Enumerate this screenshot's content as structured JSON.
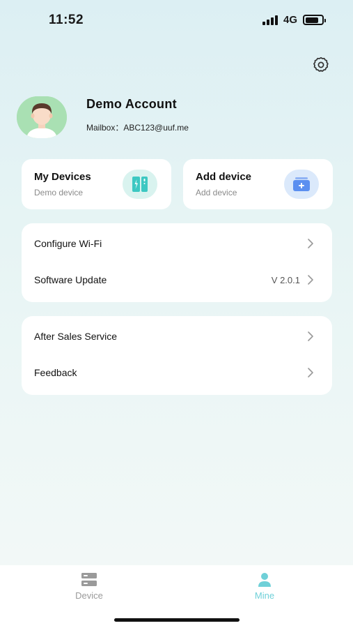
{
  "status": {
    "time": "11:52",
    "network": "4G",
    "battery_level": 0.82
  },
  "header": {
    "settings_icon": "gear-icon"
  },
  "profile": {
    "name": "Demo Account",
    "mailbox": "Mailbox：ABC123@uuf.me"
  },
  "tiles": {
    "my_devices": {
      "title": "My Devices",
      "subtitle": "Demo device",
      "icon": "devices-icon"
    },
    "add_device": {
      "title": "Add device",
      "subtitle": "Add device",
      "icon": "add-device-icon"
    }
  },
  "menu": {
    "configure_wifi": {
      "label": "Configure Wi-Fi"
    },
    "software_update": {
      "label": "Software Update",
      "value": "V 2.0.1"
    },
    "after_sales": {
      "label": "After Sales Service"
    },
    "feedback": {
      "label": "Feedback"
    }
  },
  "tabbar": {
    "device": {
      "label": "Device"
    },
    "mine": {
      "label": "Mine",
      "active": true
    }
  },
  "colors": {
    "accent": "#6fd0d8",
    "tab_inactive": "#9a9a9a",
    "device_icon_bg": "#d9f3ef",
    "add_icon_bg": "#dbe9fb"
  }
}
